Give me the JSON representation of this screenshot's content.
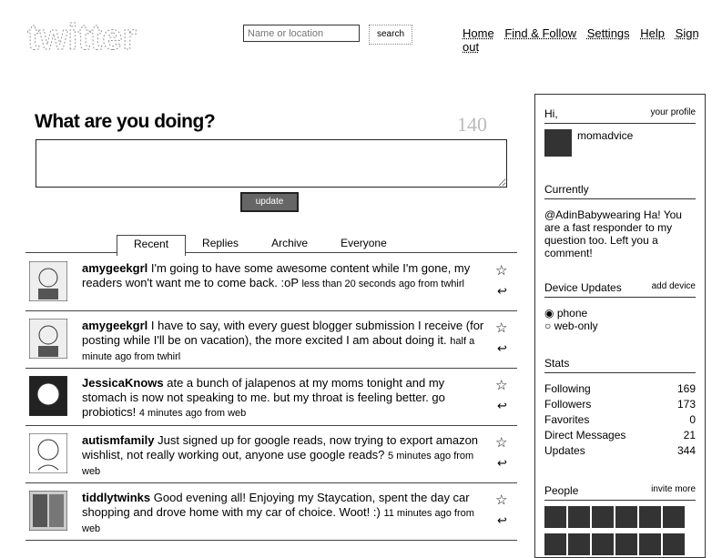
{
  "header": {
    "search_placeholder": "Name or location",
    "search_button": "search",
    "nav": [
      "Home",
      "Find & Follow",
      "Settings",
      "Help",
      "Sign out"
    ]
  },
  "main": {
    "heading": "What are you doing?",
    "counter": "140",
    "update_button": "update",
    "tabs": [
      "Recent",
      "Replies",
      "Archive",
      "Everyone"
    ],
    "tweets": [
      {
        "user": "amygeekgrl",
        "text": "I'm going to have some awesome content while I'm gone, my readers won't want me to come back. :oP",
        "meta": "less than 20 seconds ago from twhirl"
      },
      {
        "user": "amygeekgrl",
        "text": "I have to say, with every guest blogger submission I receive (for posting while I'll be on vacation), the more excited I am about doing it.",
        "meta": "half a minute ago from twhirl"
      },
      {
        "user": "JessicaKnows",
        "text": "ate a bunch of jalapenos at my moms tonight and my stomach is now not speaking to me. but my throat is feeling better. go probiotics!",
        "meta": "4 minutes ago from web"
      },
      {
        "user": "autismfamily",
        "text": "Just signed up for google reads, now trying to export amazon wishlist, not really working out, anyone use google reads?",
        "meta": "5 minutes ago from web"
      },
      {
        "user": "tiddlytwinks",
        "text": "Good evening all! Enjoying my Staycation, spent the day car shopping and drove home with my car of choice. Woot! :)",
        "meta": "11 minutes ago from web"
      }
    ]
  },
  "sidebar": {
    "hi": "Hi,",
    "your_profile": "your profile",
    "username": "momadvice",
    "currently_label": "Currently",
    "currently_text": "@AdinBabywearing Ha! You are a fast responder to my question too. Left you a comment!",
    "device_label": "Device Updates",
    "add_device": "add device",
    "device_options": [
      "phone",
      "web-only"
    ],
    "stats_label": "Stats",
    "stats": [
      {
        "label": "Following",
        "value": "169"
      },
      {
        "label": "Followers",
        "value": "173"
      },
      {
        "label": "Favorites",
        "value": "0"
      },
      {
        "label": "Direct Messages",
        "value": "21"
      },
      {
        "label": "Updates",
        "value": "344"
      }
    ],
    "people_label": "People",
    "invite_more": "invite more"
  }
}
